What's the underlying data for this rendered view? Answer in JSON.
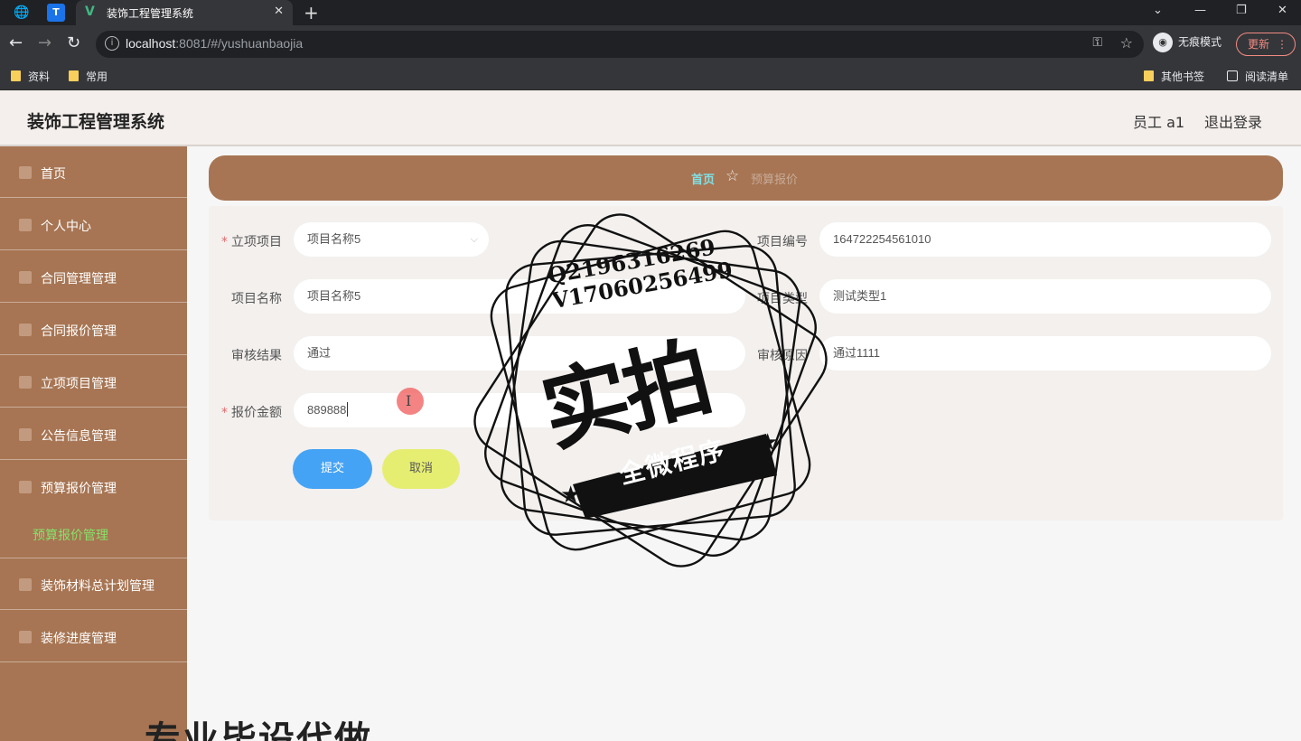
{
  "browser": {
    "tab_title": "装饰工程管理系统",
    "url_host": "localhost",
    "url_path": ":8081/#/yushuanbaojia",
    "incognito_label": "无痕模式",
    "update_label": "更新",
    "bookmarks": [
      "资料",
      "常用"
    ],
    "bookmarks_right": [
      "其他书签",
      "阅读清单"
    ]
  },
  "app": {
    "title": "装饰工程管理系统",
    "user": "员工 a1",
    "logout": "退出登录"
  },
  "sidebar": {
    "items": [
      {
        "label": "首页",
        "icon": "home-icon"
      },
      {
        "label": "个人中心",
        "icon": "user-icon"
      },
      {
        "label": "合同管理管理",
        "icon": "contract-icon"
      },
      {
        "label": "合同报价管理",
        "icon": "list-icon"
      },
      {
        "label": "立项项目管理",
        "icon": "doc-icon"
      },
      {
        "label": "公告信息管理",
        "icon": "notice-icon"
      },
      {
        "label": "预算报价管理",
        "icon": "budget-icon"
      }
    ],
    "sub_item": "预算报价管理",
    "items_after": [
      {
        "label": "装饰材料总计划管理",
        "icon": "material-icon"
      },
      {
        "label": "装修进度管理",
        "icon": "chart-icon"
      }
    ]
  },
  "breadcrumb": {
    "home": "首页",
    "current": "预算报价"
  },
  "form": {
    "project_label": "立项项目",
    "project_value": "项目名称5",
    "project_no_label": "项目编号",
    "project_no_value": "164722254561010",
    "project_name_label": "项目名称",
    "project_name_value": "项目名称5",
    "project_type_label": "项目类型",
    "project_type_value": "测试类型1",
    "review_result_label": "审核结果",
    "review_result_value": "通过",
    "review_reason_label": "审核原因",
    "review_reason_value": "通过1111",
    "price_label": "报价金额",
    "price_value": "889888",
    "submit": "提交",
    "cancel": "取消"
  },
  "watermark": {
    "line1": "Q2196316269",
    "line2": "V17060256499",
    "big": "实拍",
    "band": "全微程序",
    "bottom": "专业毕设代做"
  }
}
